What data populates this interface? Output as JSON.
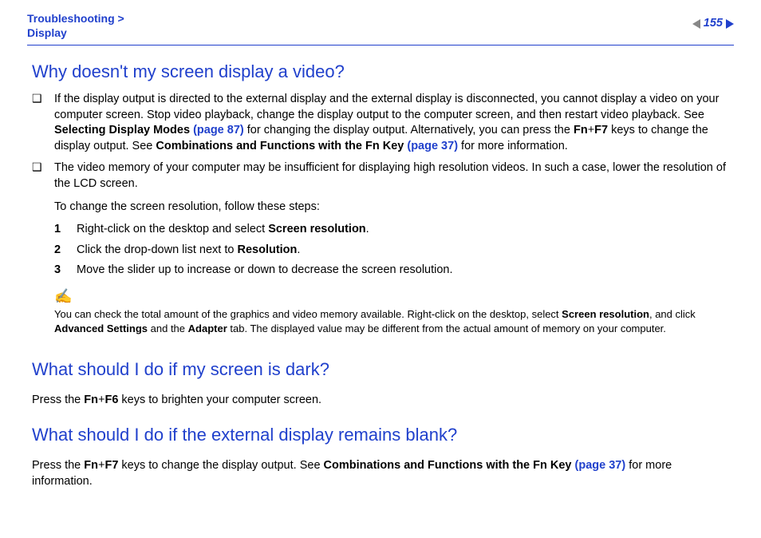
{
  "breadcrumb": {
    "top": "Troubleshooting >",
    "sub": "Display"
  },
  "page_number": "155",
  "h1": "Why doesn't my screen display a video?",
  "b1": {
    "t1": "If the display output is directed to the external display and the external display is disconnected, you cannot display a video on your computer screen. Stop video playback, change the display output to the computer screen, and then restart video playback. See ",
    "b1": "Selecting Display Modes ",
    "l1": "(page 87)",
    "t2": " for changing the display output. Alternatively, you can press the ",
    "b2": "Fn",
    "plus1": "+",
    "b3": "F7",
    "t3": " keys to change the display output. See ",
    "b4": "Combinations and Functions with the Fn Key ",
    "l2": "(page 37)",
    "t4": " for more information."
  },
  "b2": {
    "t1": "The video memory of your computer may be insufficient for displaying high resolution videos. In such a case, lower the resolution of the LCD screen.",
    "t2": "To change the screen resolution, follow these steps:"
  },
  "steps": {
    "n1": "1",
    "s1a": "Right-click on the desktop and select ",
    "s1b": "Screen resolution",
    "s1c": ".",
    "n2": "2",
    "s2a": "Click the drop-down list next to ",
    "s2b": "Resolution",
    "s2c": ".",
    "n3": "3",
    "s3": "Move the slider up to increase or down to decrease the screen resolution."
  },
  "note": {
    "t1": "You can check the total amount of the graphics and video memory available. Right-click on the desktop, select ",
    "b1": "Screen resolution",
    "t2": ", and click ",
    "b2": "Advanced Settings",
    "t3": " and the ",
    "b3": "Adapter",
    "t4": " tab. The displayed value may be different from the actual amount of memory on your computer."
  },
  "h2": "What should I do if my screen is dark?",
  "p2": {
    "a": "Press the ",
    "b1": "Fn",
    "plus": "+",
    "b2": "F6",
    "c": " keys to brighten your computer screen."
  },
  "h3": "What should I do if the external display remains blank?",
  "p3": {
    "a": "Press the ",
    "b1": "Fn",
    "plus": "+",
    "b2": "F7",
    "c": " keys to change the display output. See ",
    "b3": "Combinations and Functions with the Fn Key ",
    "l": "(page 37)",
    "d": " for more information."
  }
}
